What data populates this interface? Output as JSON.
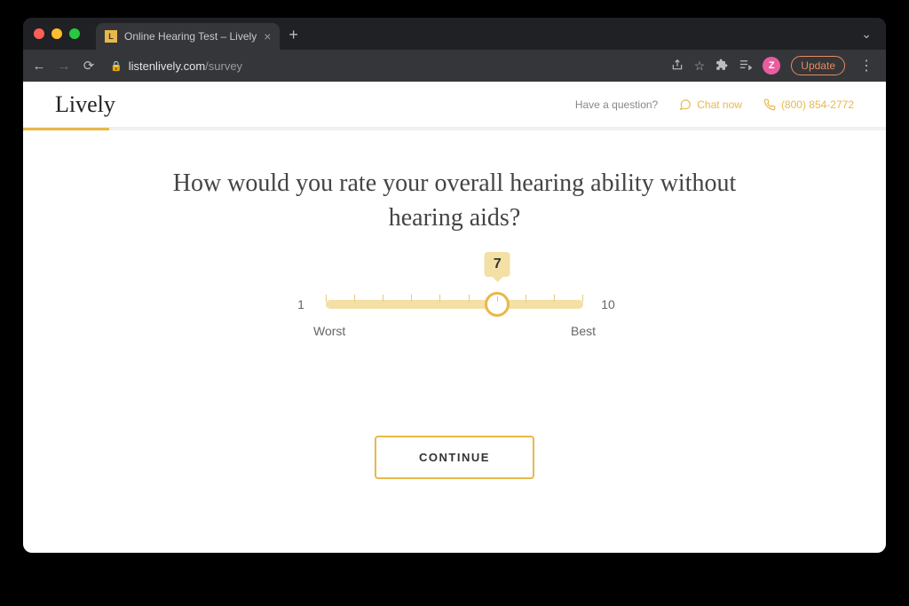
{
  "browser": {
    "tab": {
      "title": "Online Hearing Test – Lively",
      "favicon_letter": "L"
    },
    "url": {
      "domain": "listenlively.com",
      "path": "/survey"
    },
    "update_label": "Update",
    "avatar_letter": "Z"
  },
  "header": {
    "logo": "Lively",
    "question_prompt": "Have a question?",
    "chat_label": "Chat now",
    "phone": "(800) 854-2772"
  },
  "progress": {
    "percent": 10
  },
  "survey": {
    "question": "How would you rate your overall hearing ability without hearing aids?",
    "slider": {
      "min": 1,
      "max": 10,
      "value": 7,
      "min_label": "1",
      "max_label": "10",
      "worst_label": "Worst",
      "best_label": "Best"
    },
    "continue_label": "CONTINUE"
  },
  "colors": {
    "accent": "#e8b84a",
    "accent_light": "#f4dfa5"
  }
}
